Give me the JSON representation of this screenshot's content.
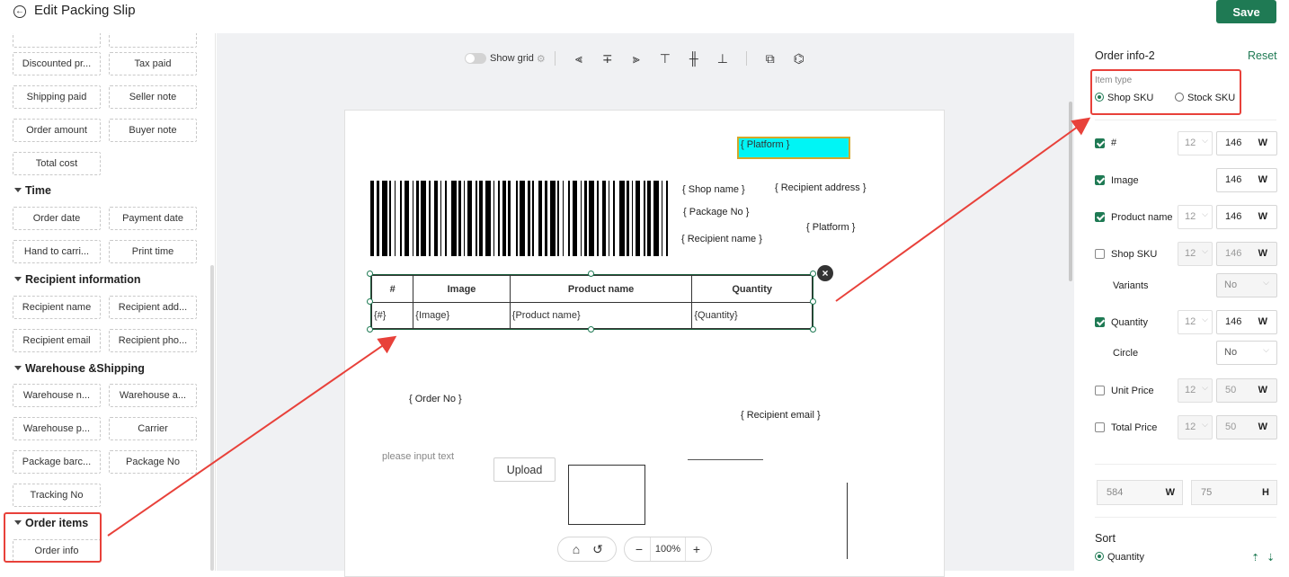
{
  "header": {
    "title": "Edit Packing Slip",
    "save_label": "Save"
  },
  "left_panel": {
    "top_buttons": [
      "Discounted pr...",
      "Tax paid",
      "Shipping paid",
      "Seller note",
      "Order amount",
      "Buyer note",
      "Total cost"
    ],
    "sections": {
      "time": {
        "title": "Time",
        "items": [
          "Order date",
          "Payment date",
          "Hand to carri...",
          "Print time"
        ]
      },
      "recipient": {
        "title": "Recipient information",
        "items": [
          "Recipient name",
          "Recipient add...",
          "Recipient email",
          "Recipient pho..."
        ]
      },
      "warehouse": {
        "title": "Warehouse &Shipping",
        "items": [
          "Warehouse n...",
          "Warehouse a...",
          "Warehouse p...",
          "Carrier",
          "Package barc...",
          "Package No",
          "Tracking No"
        ]
      },
      "order_items": {
        "title": "Order items",
        "items": [
          "Order info"
        ]
      }
    }
  },
  "toolbar": {
    "show_grid_label": "Show grid",
    "show_grid": false
  },
  "canvas": {
    "placeholders": {
      "platform_top": "{ Platform }",
      "shop_name": "{ Shop name }",
      "recipient_address": "{ Recipient address }",
      "package_no": "{ Package No }",
      "platform_right": "{ Platform }",
      "recipient_name": "{ Recipient name }",
      "order_no": "{ Order No }",
      "recipient_email": "{ Recipient email }",
      "input_text": "please input text"
    },
    "table": {
      "headers": [
        "#",
        "Image",
        "Product name",
        "Quantity"
      ],
      "row": [
        "{#}",
        "{Image}",
        "{Product name}",
        "{Quantity}"
      ]
    },
    "upload_label": "Upload"
  },
  "zoom": {
    "value": "100%"
  },
  "right_panel": {
    "title": "Order info-2",
    "reset_label": "Reset",
    "item_type": {
      "label": "Item type",
      "options": [
        "Shop SKU",
        "Stock SKU"
      ],
      "selected": "Shop SKU"
    },
    "fields": [
      {
        "label": "#",
        "checked": true,
        "font": "12",
        "width": "146",
        "unit": "W"
      },
      {
        "label": "Image",
        "checked": true,
        "width": "146",
        "unit": "W"
      },
      {
        "label": "Product name",
        "checked": true,
        "font": "12",
        "width": "146",
        "unit": "W"
      },
      {
        "label": "Shop SKU",
        "checked": false,
        "font": "12",
        "width": "146",
        "unit": "W"
      },
      {
        "label": "Variants",
        "select": "No"
      },
      {
        "label": "Quantity",
        "checked": true,
        "font": "12",
        "width": "146",
        "unit": "W"
      },
      {
        "label": "Circle",
        "select": "No"
      },
      {
        "label": "Unit Price",
        "checked": false,
        "font": "12",
        "width": "50",
        "unit": "W"
      },
      {
        "label": "Total Price",
        "checked": false,
        "font": "12",
        "width": "50",
        "unit": "W"
      }
    ],
    "size": {
      "width": "584",
      "width_unit": "W",
      "height": "75",
      "height_unit": "H"
    },
    "sort": {
      "title": "Sort",
      "option": "Quantity"
    }
  },
  "colors": {
    "accent": "#1f7a54",
    "highlight": "#e8413a",
    "platform_fill": "#00f5f5"
  }
}
